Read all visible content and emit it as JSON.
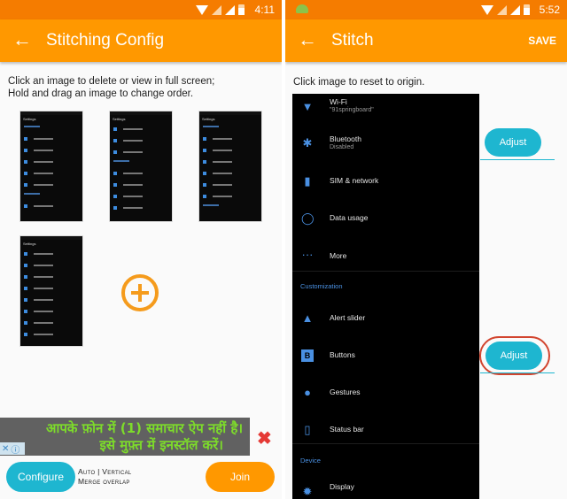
{
  "left_screen": {
    "status_time": "4:11",
    "title": "Stitching Config",
    "back_icon": "arrow-left-icon",
    "hint": "Click an image to delete or view in full screen; Hold and drag an image to change order.",
    "hint_line1": "Click an image to delete or view in full screen;",
    "hint_line2": "Hold and drag an image to change order.",
    "thumbnails": [
      {
        "header": "Settings"
      },
      {
        "header": "Settings"
      },
      {
        "header": "Settings"
      },
      {
        "header": "Settings"
      }
    ],
    "add_icon": "plus-circle-icon",
    "ad": {
      "line1": "आपके फ़ोन में (1) समाचार ऐप नहीं है।",
      "line2": "इसे मुफ़्त में इनस्टॉल करें।",
      "close_icon": "close-x-icon",
      "adchoices_x": "✕",
      "adchoices_info": "ⓘ"
    },
    "configure_label": "Configure",
    "mode_line1": "Auto | Vertical",
    "mode_line2": "Merge overlap",
    "join_label": "Join"
  },
  "right_screen": {
    "status_time": "5:52",
    "title": "Stitch",
    "save_label": "SAVE",
    "hint": "Click image to reset to origin.",
    "settings_items": [
      {
        "label": "Wi-Fi",
        "sub": "\"91springboard\"",
        "icon": "wifi-icon"
      },
      {
        "label": "Bluetooth",
        "sub": "Disabled",
        "icon": "bluetooth-icon"
      },
      {
        "label": "SIM & network",
        "icon": "sim-icon"
      },
      {
        "label": "Data usage",
        "icon": "data-usage-icon"
      },
      {
        "label": "More",
        "icon": "more-dots-icon"
      },
      {
        "label": "Alert slider",
        "icon": "bell-icon"
      },
      {
        "label": "Buttons",
        "icon": "buttons-icon"
      },
      {
        "label": "Gestures",
        "icon": "gestures-icon"
      },
      {
        "label": "Status bar",
        "icon": "status-bar-icon"
      },
      {
        "label": "Display",
        "icon": "display-icon"
      }
    ],
    "sections": [
      "Customization",
      "Device"
    ],
    "adjust_label": "Adjust",
    "colors": {
      "accent": "#ff9800",
      "statusbar": "#f57c00",
      "button": "#1eb6d0",
      "highlight": "#d2452f"
    }
  }
}
